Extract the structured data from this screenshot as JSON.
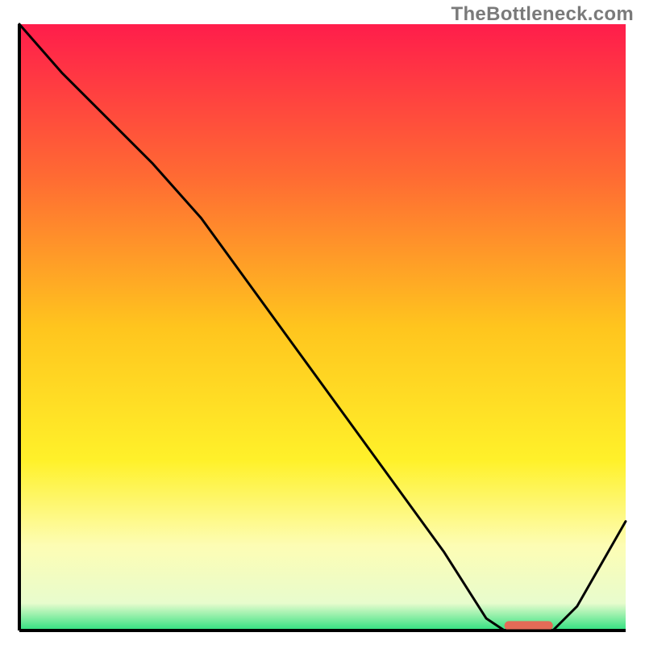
{
  "watermark": "TheBottleneck.com",
  "chart_data": {
    "type": "line",
    "title": "",
    "xlabel": "",
    "ylabel": "",
    "xlim": [
      0,
      100
    ],
    "ylim": [
      0,
      100
    ],
    "grid": false,
    "legend": false,
    "background_gradient": {
      "stops": [
        {
          "pos": 0.0,
          "color": "#ff1d4b"
        },
        {
          "pos": 0.25,
          "color": "#ff6a33"
        },
        {
          "pos": 0.5,
          "color": "#ffc51e"
        },
        {
          "pos": 0.72,
          "color": "#fff12a"
        },
        {
          "pos": 0.86,
          "color": "#fdfdb4"
        },
        {
          "pos": 0.955,
          "color": "#e8fccd"
        },
        {
          "pos": 1.0,
          "color": "#2fe07f"
        }
      ]
    },
    "axes": {
      "color": "#000000",
      "width": 4
    },
    "series": [
      {
        "name": "primary-curve",
        "color": "#000000",
        "width": 3,
        "x": [
          0,
          7,
          15,
          22,
          30,
          38,
          46,
          54,
          62,
          70,
          77,
          80,
          84,
          88,
          92,
          96,
          100
        ],
        "y": [
          100,
          92,
          84,
          77,
          68,
          57,
          46,
          35,
          24,
          13,
          2,
          0,
          0,
          0,
          4,
          11,
          18
        ]
      }
    ],
    "marker": {
      "name": "optimum-marker",
      "x_start": 80,
      "x_end": 88,
      "y": 0.8,
      "color": "#e36b57",
      "height": 1.5
    }
  }
}
